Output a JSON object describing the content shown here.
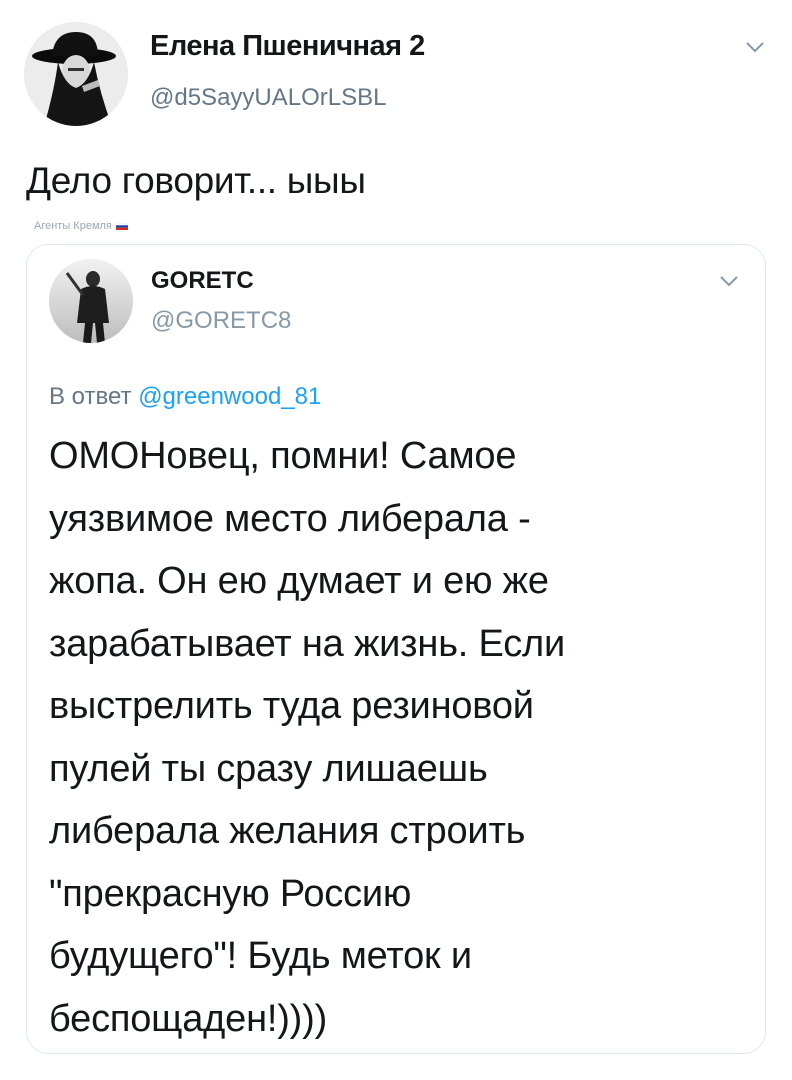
{
  "tweet": {
    "author_name": "Елена Пшеничная 2",
    "author_handle": "@d5SayyUALOrLSBL",
    "text": "Дело говорит... ыыы",
    "overlay_caption": "Агенты Кремля",
    "menu_icon": "chevron-down-icon"
  },
  "quoted": {
    "author_name": "GORETC",
    "author_handle": "@GORETC8",
    "reply_prefix": "В ответ",
    "reply_mention": "@greenwood_81",
    "body": "ОМОНовец, помни! Самое\nуязвимое место либерала -\nжопа. Он ею думает и ею же\nзарабатывает на жизнь. Если\nвыстрелить туда резиновой\nпулей ты сразу лишаешь\nлиберала желания строить\n\"прекрасную Россию\nбудущего\"! Будь меток и\nбеспощаден!))))",
    "menu_icon": "chevron-down-icon"
  },
  "colors": {
    "text": "#14171a",
    "secondary": "#657786",
    "link": "#1da1f2",
    "border": "#e1e8ed"
  }
}
